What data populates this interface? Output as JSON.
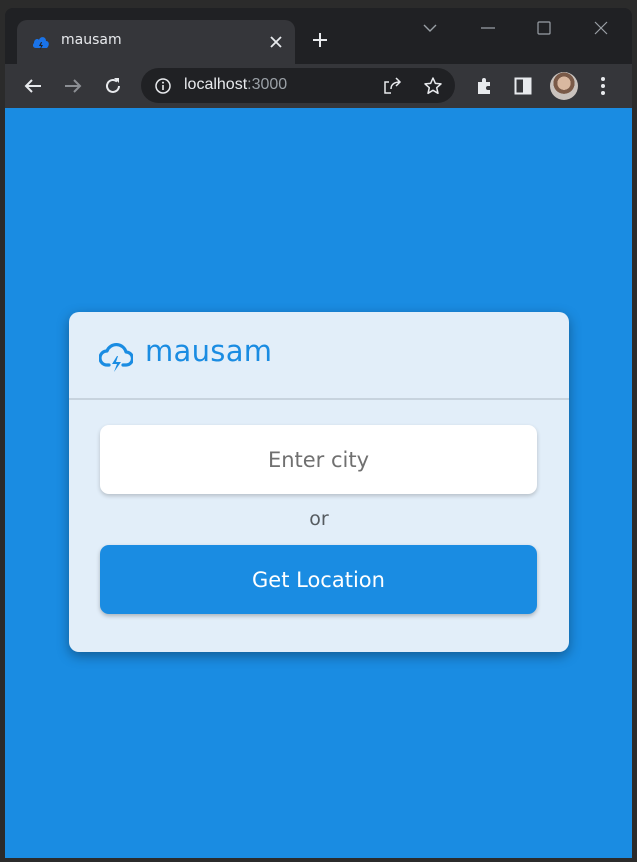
{
  "browser": {
    "tab_title": "mausam",
    "url_host": "localhost",
    "url_port": ":3000"
  },
  "app": {
    "brand": "mausam",
    "city_placeholder": "Enter city",
    "separator_text": "or",
    "get_location_label": "Get Location"
  },
  "colors": {
    "background": "#1a8ce2",
    "card": "#e2eef9",
    "accent": "#1a8ce2"
  }
}
